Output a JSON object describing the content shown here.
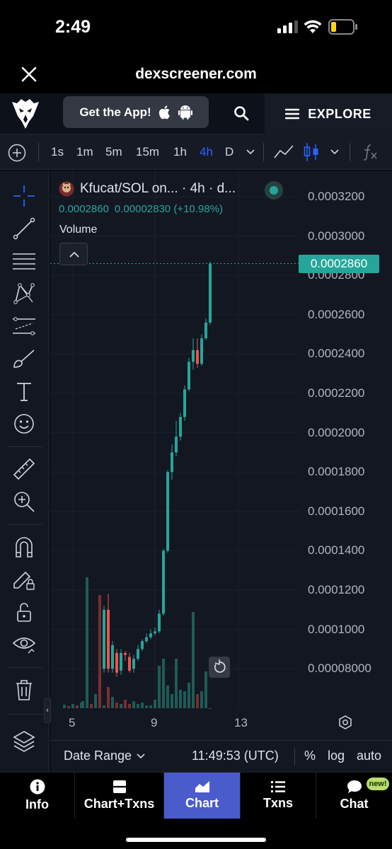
{
  "status": {
    "time": "2:49"
  },
  "browser": {
    "url": "dexscreener.com"
  },
  "topnav": {
    "get_app_label": "Get the App!",
    "explore_label": "EXPLORE"
  },
  "timeframes": {
    "items": [
      "1s",
      "1m",
      "5m",
      "15m",
      "1h",
      "4h",
      "D"
    ],
    "selected": "4h"
  },
  "chart": {
    "legend_title": "Kfucat/SOL on... · 4h · d...",
    "price": "0.0002860",
    "change": "0.00002830 (+10.98%)",
    "volume_label": "Volume",
    "current_price_tag": "0.0002860",
    "price_axis": [
      "0.0003200",
      "0.0003000",
      "0.0002800",
      "0.0002600",
      "0.0002400",
      "0.0002200",
      "0.0002000",
      "0.0001800",
      "0.0001600",
      "0.0001400",
      "0.0001200",
      "0.0001000",
      "0.00008000"
    ],
    "time_axis": [
      "5",
      "9",
      "13"
    ],
    "colors": {
      "up": "#26a69a",
      "down": "#ef5350",
      "accent": "#2962ff"
    }
  },
  "rangebar": {
    "date_range_label": "Date Range",
    "clock": "11:49:53 (UTC)",
    "percent_label": "%",
    "log_label": "log",
    "auto_label": "auto"
  },
  "tabs": [
    {
      "label": "Info",
      "icon": "info-icon"
    },
    {
      "label": "Chart+Txns",
      "icon": "split-view-icon"
    },
    {
      "label": "Chart",
      "icon": "chart-icon"
    },
    {
      "label": "Txns",
      "icon": "list-icon"
    },
    {
      "label": "Chat",
      "icon": "chat-icon",
      "badge": "new!"
    }
  ]
}
